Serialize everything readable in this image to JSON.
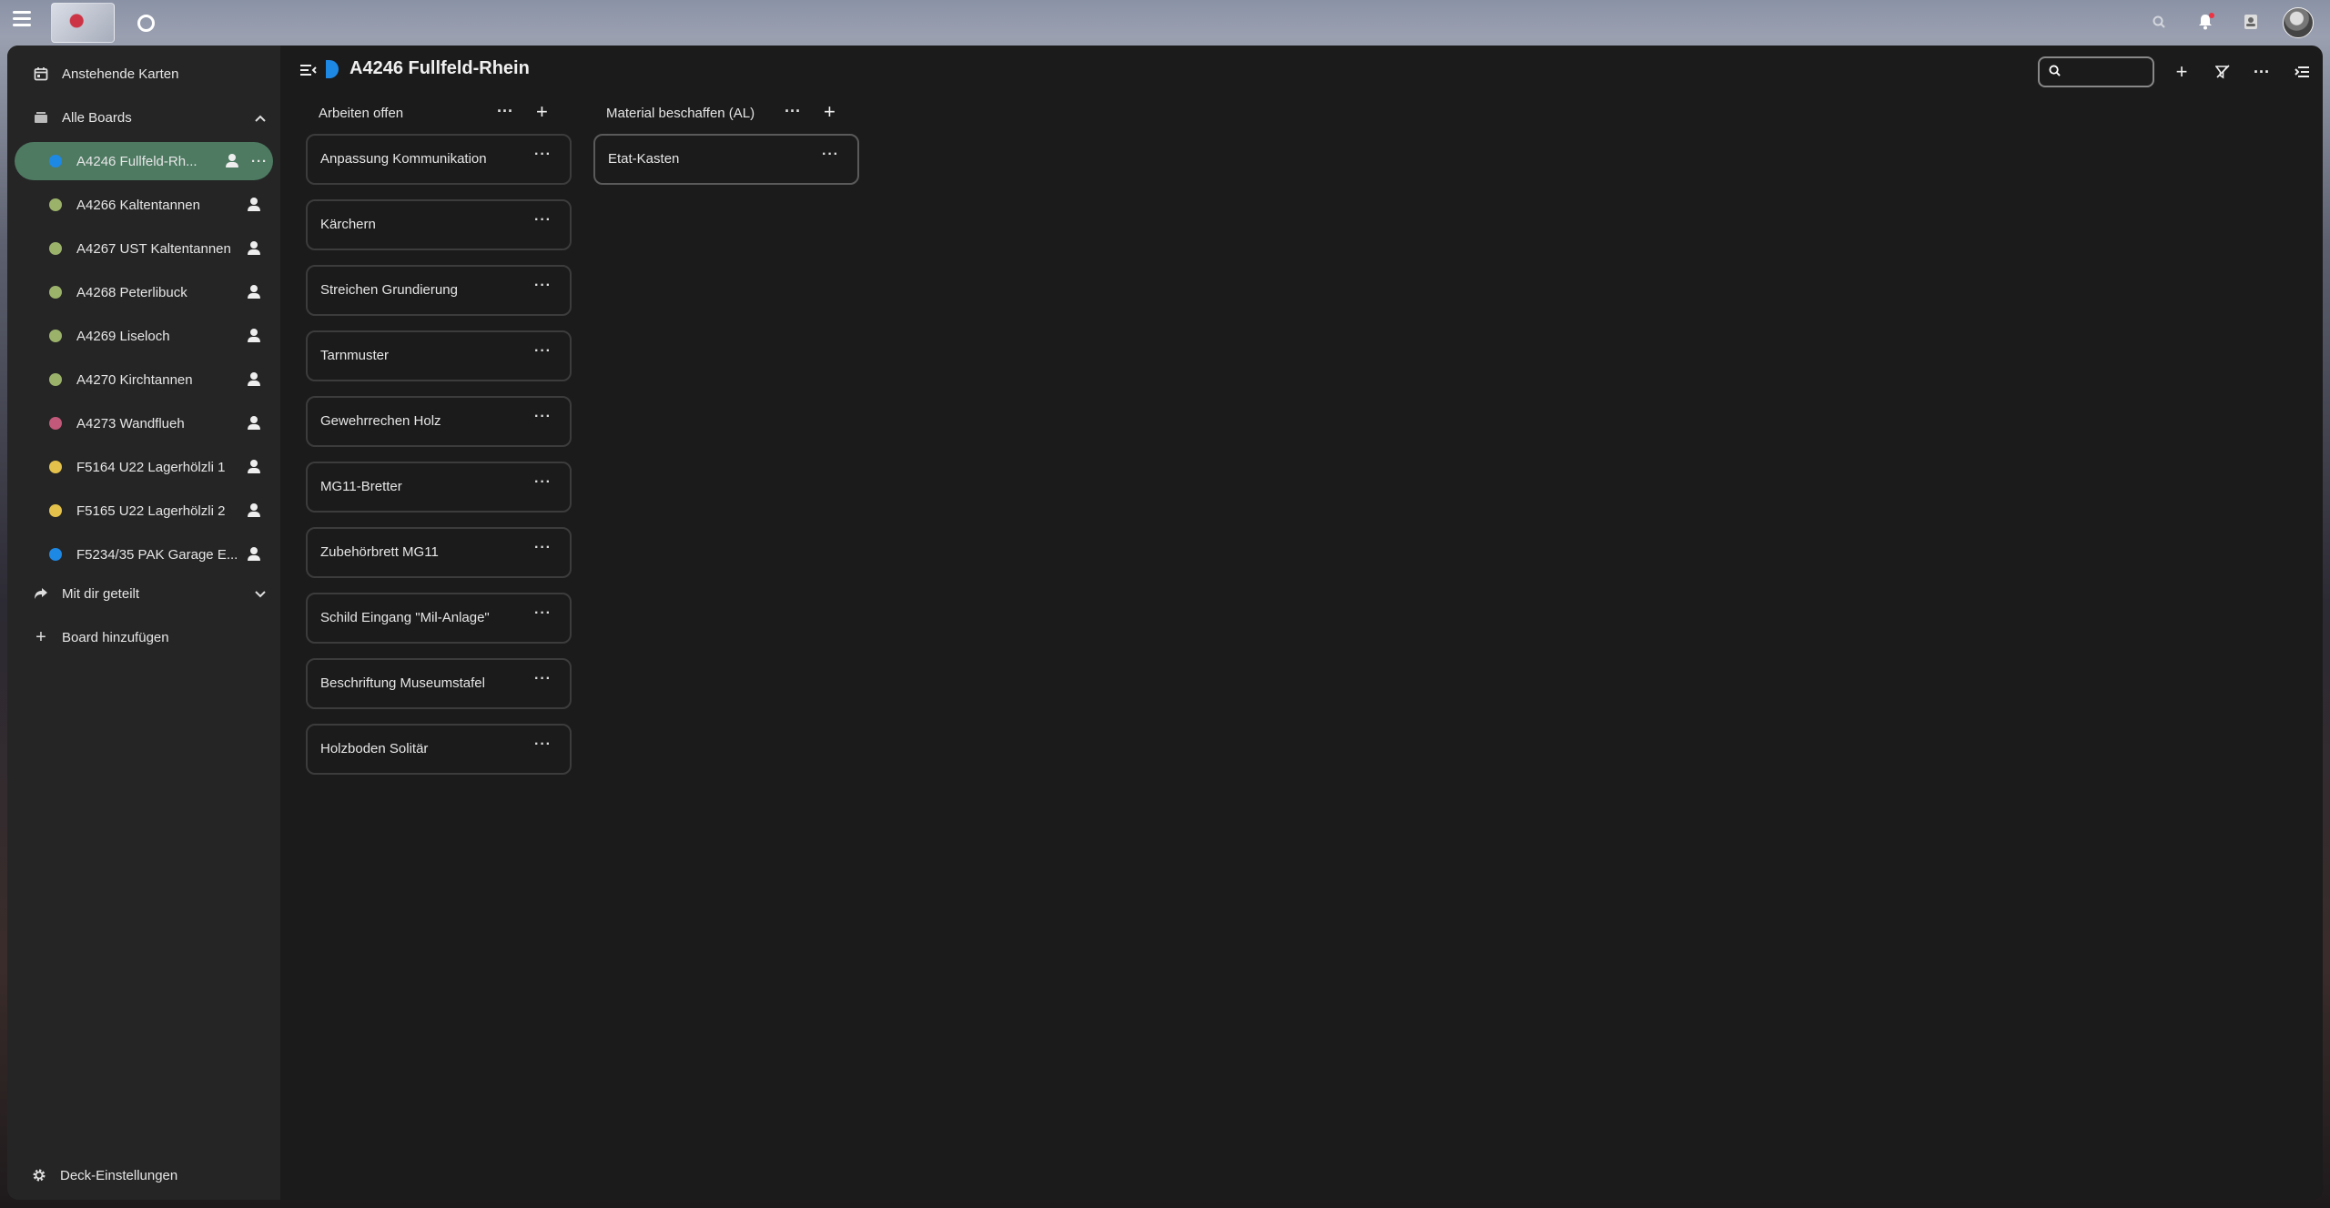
{
  "topbar": {
    "icons": [
      "menu-icon",
      "logo",
      "app-circle-icon",
      "search-icon",
      "notifications-icon",
      "contacts-icon",
      "avatar"
    ]
  },
  "sidebar": {
    "upcoming": "Anstehende Karten",
    "all_boards": "Alle Boards",
    "boards": [
      {
        "label": "A4246 Fullfeld-Rh...",
        "color": "#1e88e5",
        "active": true
      },
      {
        "label": "A4266 Kaltentannen",
        "color": "#9bb26b"
      },
      {
        "label": "A4267 UST Kaltentannen",
        "color": "#9bb26b"
      },
      {
        "label": "A4268 Peterlibuck",
        "color": "#9bb26b"
      },
      {
        "label": "A4269 Liseloch",
        "color": "#9bb26b"
      },
      {
        "label": "A4270 Kirchtannen",
        "color": "#9bb26b"
      },
      {
        "label": "A4273 Wandflueh",
        "color": "#c2587a"
      },
      {
        "label": "F5164 U22 Lagerhölzli 1",
        "color": "#e3c14b"
      },
      {
        "label": "F5165 U22 Lagerhölzli 2",
        "color": "#e3c14b"
      },
      {
        "label": "F5234/35 PAK Garage E...",
        "color": "#1e88e5"
      }
    ],
    "shared": "Mit dir geteilt",
    "add_board": "Board hinzufügen",
    "settings": "Deck-Einstellungen"
  },
  "header": {
    "title": "A4246 Fullfeld-Rhein",
    "search_value": "",
    "board_color": "#1e88e5"
  },
  "stacks": [
    {
      "title": "Arbeiten offen",
      "cards": [
        "Anpassung Kommunikation",
        "Kärchern",
        "Streichen Grundierung",
        "Tarnmuster",
        "Gewehrrechen Holz",
        "MG11-Bretter",
        "Zubehörbrett MG11",
        "Schild Eingang \"Mil-Anlage\"",
        "Beschriftung Museumstafel",
        "Holzboden Solitär"
      ]
    },
    {
      "title": "Material beschaffen (AL)",
      "cards": [
        "Etat-Kasten"
      ]
    }
  ],
  "glyphs": {
    "more": "···",
    "add": "+"
  }
}
